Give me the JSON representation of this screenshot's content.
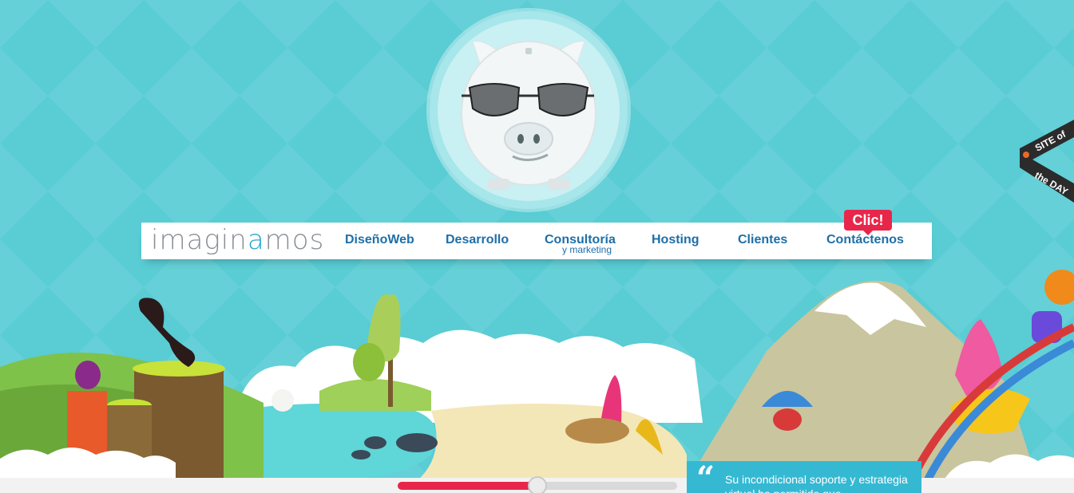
{
  "brand": {
    "logo_prefix": "imagin",
    "logo_accent": "a",
    "logo_suffix": "mos"
  },
  "nav": {
    "items": [
      {
        "label": "DiseñoWeb"
      },
      {
        "label": "Desarrollo"
      },
      {
        "label": "Consultoría",
        "sublabel": "y marketing"
      },
      {
        "label": "Hosting"
      },
      {
        "label": "Clientes"
      },
      {
        "label": "Contáctenos"
      }
    ],
    "badge": "Clic!"
  },
  "ribbon": {
    "line1": "SITE",
    "line1_small": "of",
    "line2_small": "the",
    "line2": "DAY"
  },
  "slider": {
    "progress_fraction": 0.5
  },
  "testimonial": {
    "quote_mark": "“",
    "text": "Su incondicional soporte y estrategia virtual ha permitido que"
  },
  "colors": {
    "sky": "#59ccd4",
    "nav_text": "#1e6fa8",
    "accent_red": "#e8264a",
    "logo_accent": "#2aa6c9"
  }
}
